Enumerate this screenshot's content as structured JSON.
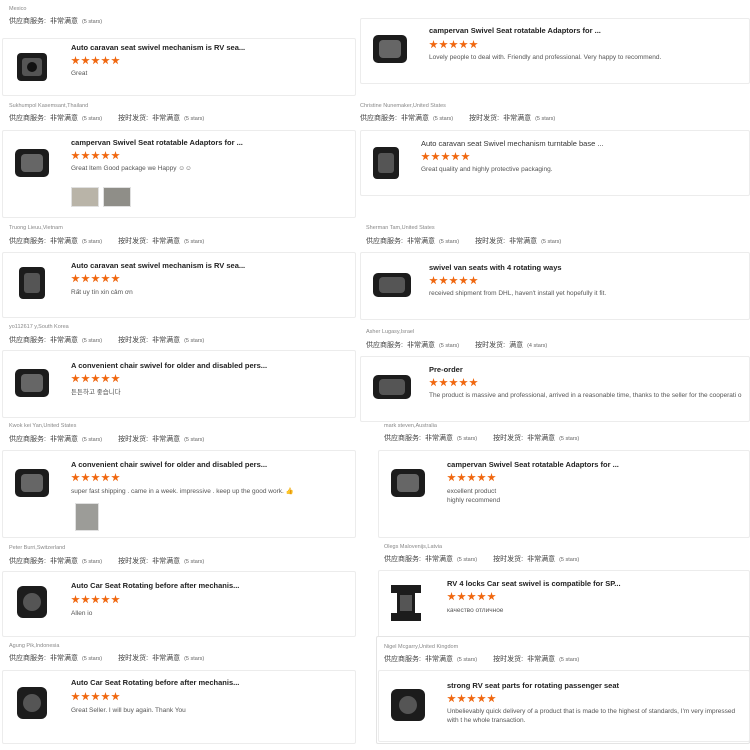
{
  "left": [
    {
      "reviewer": "Mexico",
      "svc_label": "供应商服务:",
      "svc_value": "非常满意",
      "svc_stars": "(5 stars)",
      "ship_label": "",
      "ship_value": "",
      "ship_stars": "",
      "title": "Auto caravan seat swivel mechanism is RV sea...",
      "comment": "Great",
      "photos": 0
    },
    {
      "reviewer": "Sukhumpol Kasemsant,Thailand",
      "svc_label": "供应商服务:",
      "svc_value": "非常满意",
      "svc_stars": "(5 stars)",
      "ship_label": "按时发货:",
      "ship_value": "非常满意",
      "ship_stars": "(5 stars)",
      "title": "campervan Swivel Seat rotatable Adaptors for ...",
      "comment": "Great Item Good package we Happy ☺☺",
      "photos": 2
    },
    {
      "reviewer": "Truong Lieuu,Vietnam",
      "svc_label": "供应商服务:",
      "svc_value": "非常满意",
      "svc_stars": "(5 stars)",
      "ship_label": "按时发货:",
      "ship_value": "非常满意",
      "ship_stars": "(5 stars)",
      "title": "Auto caravan seat swivel mechanism is RV sea...",
      "comment": "Rất uy tín xin cảm ơn",
      "photos": 0
    },
    {
      "reviewer": "yo112617 y,South Korea",
      "svc_label": "供应商服务:",
      "svc_value": "非常满意",
      "svc_stars": "(5 stars)",
      "ship_label": "按时发货:",
      "ship_value": "非常满意",
      "ship_stars": "(5 stars)",
      "title": "A convenient chair swivel for older and disabled pers...",
      "comment": "튼튼하고 좋습니다",
      "photos": 0
    },
    {
      "reviewer": "Kwok kei Yan,United States",
      "svc_label": "供应商服务:",
      "svc_value": "非常满意",
      "svc_stars": "(5 stars)",
      "ship_label": "按时发货:",
      "ship_value": "非常满意",
      "ship_stars": "(5 stars)",
      "title": "A convenient chair swivel for older and disabled pers...",
      "comment": "super fast shipping . came in a week. impressive . keep up the good work. 👍",
      "photos": 1
    },
    {
      "reviewer": "Peter Burri,Switzerland",
      "svc_label": "供应商服务:",
      "svc_value": "非常满意",
      "svc_stars": "(5 stars)",
      "ship_label": "按时发货:",
      "ship_value": "非常满意",
      "ship_stars": "(5 stars)",
      "title": "Auto Car Seat Rotating before after mechanis...",
      "comment": "Allen io",
      "photos": 0
    },
    {
      "reviewer": "Agung Pik,Indonesia",
      "svc_label": "供应商服务:",
      "svc_value": "非常满意",
      "svc_stars": "(5 stars)",
      "ship_label": "按时发货:",
      "ship_value": "非常满意",
      "ship_stars": "(5 stars)",
      "title": "Auto Car Seat Rotating before after mechanis...",
      "comment": "Great Seller. I will buy again. Thank You",
      "photos": 0
    }
  ],
  "right": [
    {
      "reviewer": "",
      "svc_label": "",
      "svc_value": "",
      "svc_stars": "",
      "ship_label": "",
      "ship_value": "",
      "ship_stars": "",
      "title": "campervan Swivel Seat rotatable Adaptors for ...",
      "comment": "Lovely people to deal with. Friendly and professional. Very happy to recommend.",
      "photos": 0
    },
    {
      "reviewer": "Christine Nunemaker,United States",
      "svc_label": "供应商服务:",
      "svc_value": "非常满意",
      "svc_stars": "(5 stars)",
      "ship_label": "按时发货:",
      "ship_value": "非常满意",
      "ship_stars": "(5 stars)",
      "title": "Auto caravan seat Swivel mechanism turntable base ...",
      "comment": "Great quality and highly protective packaging.",
      "photos": 0
    },
    {
      "reviewer": "Sherman Tam,United States",
      "svc_label": "供应商服务:",
      "svc_value": "非常满意",
      "svc_stars": "(5 stars)",
      "ship_label": "按时发货:",
      "ship_value": "非常满意",
      "ship_stars": "(5 stars)",
      "title": "swivel van seats with 4 rotating ways",
      "comment": "received shipment from DHL, haven't install yet hopefully it fit.",
      "photos": 0
    },
    {
      "reviewer": "Asher Lugasy,Israel",
      "svc_label": "供应商服务:",
      "svc_value": "非常满意",
      "svc_stars": "(5 stars)",
      "ship_label": "按时发货:",
      "ship_value": "满意",
      "ship_stars": "(4 stars)",
      "title": "Pre-order",
      "comment": "The product is massive and professional, arrived in a reasonable time, thanks to the seller for the cooperati o",
      "photos": 0
    },
    {
      "reviewer": "mark steven,Australia",
      "svc_label": "供应商服务:",
      "svc_value": "非常满意",
      "svc_stars": "(5 stars)",
      "ship_label": "按时发货:",
      "ship_value": "非常满意",
      "ship_stars": "(5 stars)",
      "title": "campervan Swivel Seat rotatable Adaptors for ...",
      "comment": "excellent product\nhighly recommend",
      "photos": 0
    },
    {
      "reviewer": "Olegs Malovenijs,Latvia",
      "svc_label": "供应商服务:",
      "svc_value": "非常满意",
      "svc_stars": "(5 stars)",
      "ship_label": "按时发货:",
      "ship_value": "非常满意",
      "ship_stars": "(5 stars)",
      "title": "RV 4 locks Car seat swivel is compatible for SP...",
      "comment": "качество отличное",
      "photos": 0
    },
    {
      "reviewer": "Nigel Mcgarry,United Kingdom",
      "svc_label": "供应商服务:",
      "svc_value": "非常满意",
      "svc_stars": "(5 stars)",
      "ship_label": "按时发货:",
      "ship_value": "非常满意",
      "ship_stars": "(5 stars)",
      "title": "strong RV seat parts for rotating passenger seat",
      "comment": "Unbelievably quick delivery of a product that is made to the highest of standards, I'm very impressed with t he whole transaction.",
      "photos": 0
    }
  ],
  "star_color": "#f0670f"
}
